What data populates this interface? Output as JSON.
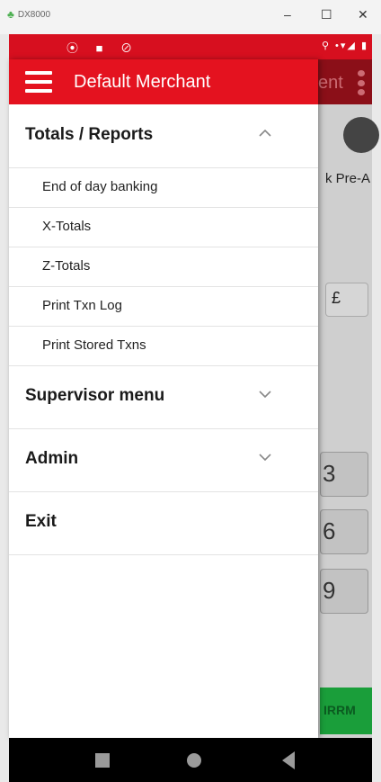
{
  "window": {
    "title": "DX8000",
    "minimize": "–",
    "maximize": "☐",
    "close": "✕"
  },
  "statusbar": {
    "left_icons": "⦿ ■ ⊘",
    "right_icons": "⚲ •▾◢ ▮"
  },
  "background_app": {
    "toolbar_text": "ent",
    "mode_label": "k Pre-A",
    "currency": "£",
    "keys": [
      "3",
      "6",
      "9"
    ],
    "confirm": "IRRM"
  },
  "drawer": {
    "title": "Default Merchant",
    "groups": [
      {
        "label": "Totals / Reports",
        "expanded": true,
        "items": [
          {
            "label": "End of day banking"
          },
          {
            "label": "X-Totals"
          },
          {
            "label": "Z-Totals"
          },
          {
            "label": "Print Txn Log"
          },
          {
            "label": "Print Stored Txns"
          }
        ]
      },
      {
        "label": "Supervisor menu",
        "expanded": false
      },
      {
        "label": "Admin",
        "expanded": false
      },
      {
        "label": "Exit"
      }
    ]
  },
  "colors": {
    "accent_red": "#e4121f",
    "status_red": "#d70f1f"
  }
}
